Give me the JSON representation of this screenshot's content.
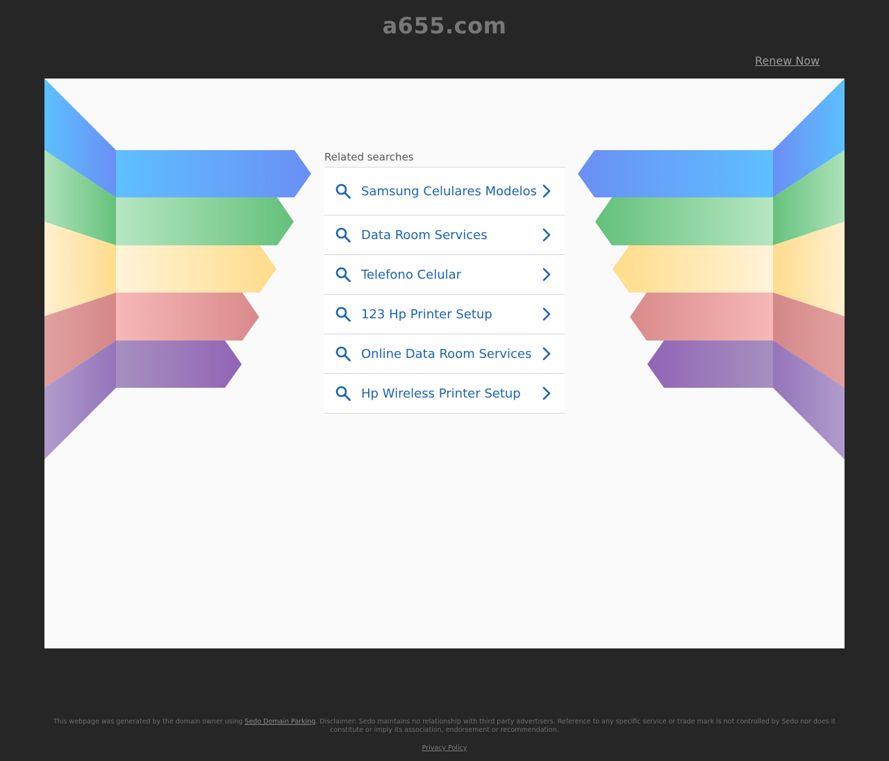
{
  "header": {
    "domain": "a655.com",
    "renew_label": "Renew Now"
  },
  "related": {
    "heading": "Related searches",
    "items": [
      {
        "label": "Samsung Celulares Modelos"
      },
      {
        "label": "Data Room Services"
      },
      {
        "label": "Telefono Celular"
      },
      {
        "label": "123 Hp Printer Setup"
      },
      {
        "label": "Online Data Room Services"
      },
      {
        "label": "Hp Wireless Printer Setup"
      }
    ],
    "icon": "search-icon",
    "chevron": "chevron-right-icon"
  },
  "footer": {
    "text_before": "This webpage was generated by the domain owner using ",
    "link_label": "Sedo Domain Parking",
    "text_after": ". Disclaimer: Sedo maintains no relationship with third party advertisers. Reference to any specific service or trade mark is not controlled by Sedo nor does it constitute or imply its association, endorsement or recommendation.",
    "privacy_label": "Privacy Policy"
  },
  "colors": {
    "background": "#262626",
    "panel": "#fafafa",
    "link_blue": "#1a64b4",
    "band_blue": "#5fbcff",
    "band_green": "#6cc47e",
    "band_yellow": "#ffe09a",
    "band_red": "#d98a8a",
    "band_purple": "#9b79bf"
  }
}
